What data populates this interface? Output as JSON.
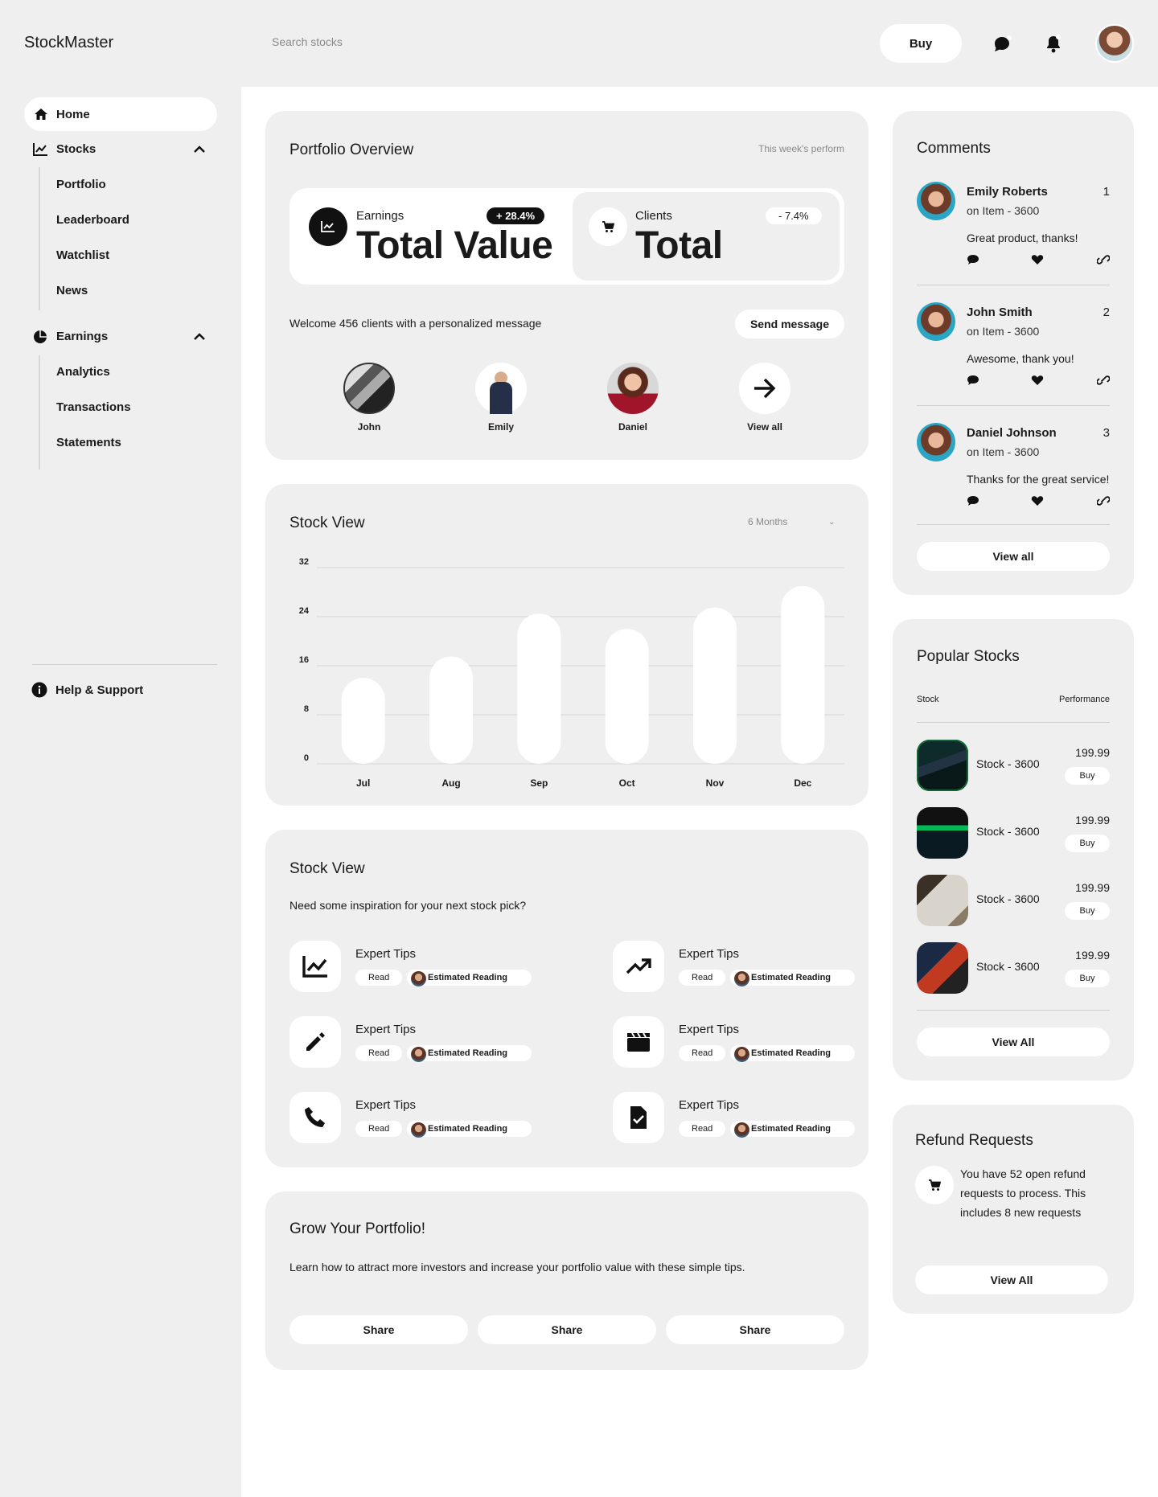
{
  "header": {
    "brand": "StockMaster",
    "search_placeholder": "Search stocks",
    "buy_label": "Buy",
    "icons": [
      "chat-icon",
      "bell-icon"
    ]
  },
  "sidebar": {
    "home": "Home",
    "stocks": {
      "label": "Stocks",
      "items": [
        "Portfolio",
        "Leaderboard",
        "Watchlist",
        "News"
      ]
    },
    "earnings": {
      "label": "Earnings",
      "items": [
        "Analytics",
        "Transactions",
        "Statements"
      ]
    },
    "help": "Help & Support"
  },
  "portfolio": {
    "title": "Portfolio Overview",
    "period": "This week's perform",
    "earnings_label": "Earnings",
    "earnings_value": "Total Value",
    "earnings_change": "+ 28.4%",
    "clients_label": "Clients",
    "clients_value": "Total",
    "clients_change": "- 7.4%",
    "welcome": "Welcome 456 clients with a personalized message",
    "send_label": "Send message",
    "clients": [
      "John",
      "Emily",
      "Daniel"
    ],
    "view_all": "View all"
  },
  "stock_view": {
    "title": "Stock View",
    "range": "6 Months"
  },
  "chart_data": {
    "type": "bar",
    "categories": [
      "Jul",
      "Aug",
      "Sep",
      "Oct",
      "Nov",
      "Dec"
    ],
    "values": [
      14,
      17.5,
      24.5,
      22,
      25.5,
      29
    ],
    "title": "",
    "xlabel": "",
    "ylabel": "",
    "ylim": [
      0,
      32
    ],
    "yticks": [
      0,
      8,
      16,
      24,
      32
    ],
    "grid": true,
    "bar_color": "#ffffff",
    "grid_color": "#d9d9d9"
  },
  "tips": {
    "title": "Stock View",
    "subtitle": "Need some inspiration for your next stock pick?",
    "items": [
      {
        "title": "Expert Tips",
        "read": "Read",
        "est": "Estimated Reading",
        "icon": "line-chart-icon"
      },
      {
        "title": "Expert Tips",
        "read": "Read",
        "est": "Estimated Reading",
        "icon": "trending-up-icon"
      },
      {
        "title": "Expert Tips",
        "read": "Read",
        "est": "Estimated Reading",
        "icon": "pencil-icon"
      },
      {
        "title": "Expert Tips",
        "read": "Read",
        "est": "Estimated Reading",
        "icon": "clapperboard-icon"
      },
      {
        "title": "Expert Tips",
        "read": "Read",
        "est": "Estimated Reading",
        "icon": "phone-icon"
      },
      {
        "title": "Expert Tips",
        "read": "Read",
        "est": "Estimated Reading",
        "icon": "document-check-icon"
      }
    ]
  },
  "grow": {
    "title": "Grow Your Portfolio!",
    "desc": "Learn how to attract more investors and increase your portfolio value with these simple tips.",
    "share": [
      "Share",
      "Share",
      "Share"
    ]
  },
  "comments": {
    "title": "Comments",
    "items": [
      {
        "name": "Emily Roberts",
        "num": "1",
        "on": "on Item - 3600",
        "text": "Great product, thanks!"
      },
      {
        "name": "John Smith",
        "num": "2",
        "on": "on Item - 3600",
        "text": "Awesome, thank you!"
      },
      {
        "name": "Daniel Johnson",
        "num": "3",
        "on": "on Item - 3600",
        "text": "Thanks for the great service!"
      }
    ],
    "view_all": "View all"
  },
  "popular": {
    "title": "Popular Stocks",
    "col_stock": "Stock",
    "col_perf": "Performance",
    "items": [
      {
        "name": "Stock - 3600",
        "price": "199.99",
        "buy": "Buy"
      },
      {
        "name": "Stock - 3600",
        "price": "199.99",
        "buy": "Buy"
      },
      {
        "name": "Stock - 3600",
        "price": "199.99",
        "buy": "Buy"
      },
      {
        "name": "Stock - 3600",
        "price": "199.99",
        "buy": "Buy"
      }
    ],
    "view_all": "View All"
  },
  "refund": {
    "title": "Refund Requests",
    "text": "You have 52 open refund requests to process. This includes 8 new requests",
    "view_all": "View All"
  }
}
